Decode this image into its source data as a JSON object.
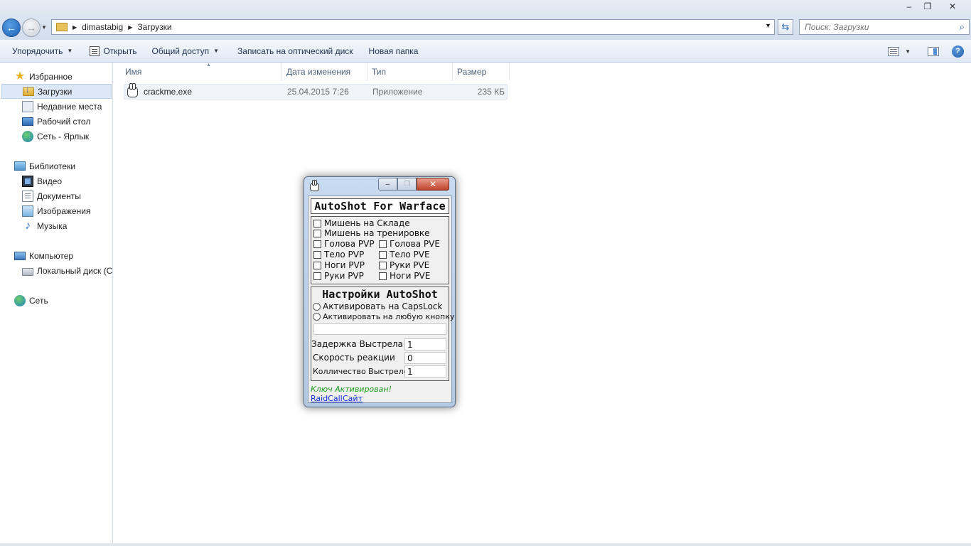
{
  "window": {
    "minimize_glyph": "–",
    "maximize_glyph": "❐",
    "close_glyph": "✕"
  },
  "navigation": {
    "back_glyph": "←",
    "forward_glyph": "→",
    "breadcrumbs": [
      "dimastabig",
      "Загрузки"
    ],
    "search_placeholder": "Поиск: Загрузки"
  },
  "commands": {
    "organize": "Упорядочить",
    "open": "Открыть",
    "share": "Общий доступ",
    "burn": "Записать на оптический диск",
    "new_folder": "Новая папка"
  },
  "sidebar": {
    "favorites": "Избранное",
    "downloads": "Загрузки",
    "recent": "Недавние места",
    "desktop": "Рабочий стол",
    "network_shortcut": "Сеть - Ярлык",
    "libraries": "Библиотеки",
    "video": "Видео",
    "documents": "Документы",
    "images": "Изображения",
    "music": "Музыка",
    "computer": "Компьютер",
    "local_disk": "Локальный диск (C:)",
    "network": "Сеть"
  },
  "files": {
    "columns": {
      "name": "Имя",
      "modified": "Дата изменения",
      "type": "Тип",
      "size": "Размер"
    },
    "rows": [
      {
        "name": "crackme.exe",
        "modified": "25.04.2015 7:26",
        "type": "Приложение",
        "size": "235 КБ"
      }
    ]
  },
  "dialog": {
    "heading": "AutoShot For Warface",
    "targets": {
      "storage": "Мишень на Складе",
      "training": "Мишень на тренировке",
      "head_pvp": "Голова PVP",
      "head_pve": "Голова PVE",
      "body_pvp": "Тело PVP",
      "body_pve": "Тело PVE",
      "legs_pvp": "Ноги PVP",
      "arms_pve": "Руки PVE",
      "arms_pvp": "Руки PVP",
      "legs_pve": "Ноги PVE"
    },
    "settings_heading": "Настройки AutoShot",
    "radio_capslock": "Активировать на CapsLock",
    "radio_any_key": "Активировать на любую кнопку",
    "delay_label": "Задержка Выстрела",
    "delay_value": "1",
    "reaction_label": "Скорость реакции",
    "reaction_value": "0",
    "shots_label": "Колличество Выстрелов",
    "shots_value": "1",
    "status": "Ключ Активирован!",
    "link_raidcall": "RaidCall",
    "link_site": "Сайт"
  }
}
